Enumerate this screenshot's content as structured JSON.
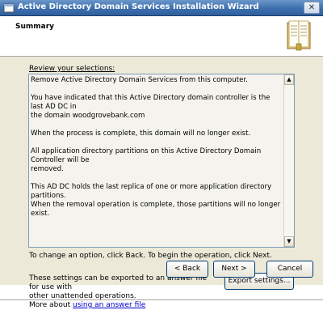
{
  "window": {
    "title": "Active Directory Domain Services Installation Wizard",
    "close_glyph": "✕"
  },
  "header": {
    "title": "Summary",
    "icon": "book-icon"
  },
  "review": {
    "label": "Review your selections:",
    "paragraphs": [
      "Remove Active Directory Domain Services from this computer.",
      "You have indicated that this Active Directory domain controller is the last AD DC in\nthe domain woodgrovebank.com",
      "When the process is complete, this domain will no longer exist.",
      "All application directory partitions on this Active Directory Domain Controller will be\nremoved.",
      "This AD DC holds the last replica of one or more application directory partitions.\nWhen the removal operation is complete, those partitions will no longer exist."
    ]
  },
  "change_text": "To change an option, click Back. To begin the operation, click Next.",
  "export": {
    "line1": "These settings can be exported to an answer file for use with",
    "line2": "other unattended operations.",
    "more_prefix": "More about ",
    "link": "using an answer file",
    "button": "Export settings..."
  },
  "footer": {
    "back": "< Back",
    "next": "Next >",
    "cancel": "Cancel"
  }
}
